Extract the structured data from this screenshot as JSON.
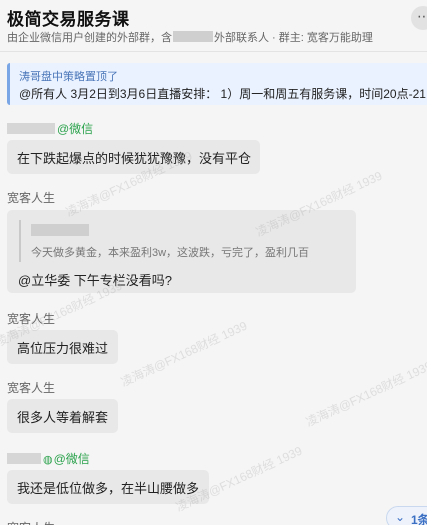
{
  "header": {
    "title": "极简交易服务课",
    "subtitle_before": "由企业微信用户创建的外部群，含",
    "subtitle_after": "外部联系人 · 群主: 宽客万能助理",
    "more_icon": "more-icon"
  },
  "pinned": {
    "title": "涛哥盘中策略置顶了",
    "text": "@所有人 3月2日到3月6日直播安排： 1）周一和周五有服务课，时间20点-21"
  },
  "messages": [
    {
      "sender": "@微信",
      "text": "在下跌起爆点的时候犹犹豫豫，没有平仓"
    },
    {
      "sender": "宽客人生",
      "quote": "今天做多黄金，本来盈利3w，这波跌，亏完了，盈利几百",
      "text": "@立华委 下午专栏没看吗?"
    },
    {
      "sender": "宽客人生",
      "text": "高位压力很难过"
    },
    {
      "sender": "宽客人生",
      "text": "很多人等着解套"
    },
    {
      "sender": "@微信",
      "text": "我还是低位做多，在半山腰做多"
    }
  ],
  "watermark": "凌海涛@FX168财经 1939",
  "new_messages": {
    "count": "1条",
    "icon": "chevron-down-icon"
  }
}
